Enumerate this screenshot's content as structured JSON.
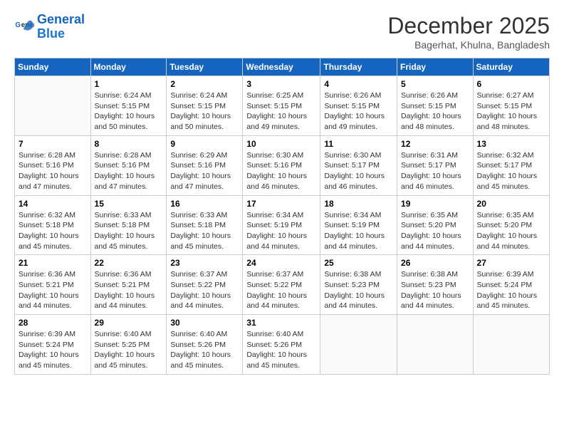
{
  "logo": {
    "line1": "General",
    "line2": "Blue"
  },
  "title": "December 2025",
  "subtitle": "Bagerhat, Khulna, Bangladesh",
  "weekdays": [
    "Sunday",
    "Monday",
    "Tuesday",
    "Wednesday",
    "Thursday",
    "Friday",
    "Saturday"
  ],
  "weeks": [
    [
      {
        "day": "",
        "sunrise": "",
        "sunset": "",
        "daylight": ""
      },
      {
        "day": "1",
        "sunrise": "Sunrise: 6:24 AM",
        "sunset": "Sunset: 5:15 PM",
        "daylight": "Daylight: 10 hours and 50 minutes."
      },
      {
        "day": "2",
        "sunrise": "Sunrise: 6:24 AM",
        "sunset": "Sunset: 5:15 PM",
        "daylight": "Daylight: 10 hours and 50 minutes."
      },
      {
        "day": "3",
        "sunrise": "Sunrise: 6:25 AM",
        "sunset": "Sunset: 5:15 PM",
        "daylight": "Daylight: 10 hours and 49 minutes."
      },
      {
        "day": "4",
        "sunrise": "Sunrise: 6:26 AM",
        "sunset": "Sunset: 5:15 PM",
        "daylight": "Daylight: 10 hours and 49 minutes."
      },
      {
        "day": "5",
        "sunrise": "Sunrise: 6:26 AM",
        "sunset": "Sunset: 5:15 PM",
        "daylight": "Daylight: 10 hours and 48 minutes."
      },
      {
        "day": "6",
        "sunrise": "Sunrise: 6:27 AM",
        "sunset": "Sunset: 5:15 PM",
        "daylight": "Daylight: 10 hours and 48 minutes."
      }
    ],
    [
      {
        "day": "7",
        "sunrise": "Sunrise: 6:28 AM",
        "sunset": "Sunset: 5:16 PM",
        "daylight": "Daylight: 10 hours and 47 minutes."
      },
      {
        "day": "8",
        "sunrise": "Sunrise: 6:28 AM",
        "sunset": "Sunset: 5:16 PM",
        "daylight": "Daylight: 10 hours and 47 minutes."
      },
      {
        "day": "9",
        "sunrise": "Sunrise: 6:29 AM",
        "sunset": "Sunset: 5:16 PM",
        "daylight": "Daylight: 10 hours and 47 minutes."
      },
      {
        "day": "10",
        "sunrise": "Sunrise: 6:30 AM",
        "sunset": "Sunset: 5:16 PM",
        "daylight": "Daylight: 10 hours and 46 minutes."
      },
      {
        "day": "11",
        "sunrise": "Sunrise: 6:30 AM",
        "sunset": "Sunset: 5:17 PM",
        "daylight": "Daylight: 10 hours and 46 minutes."
      },
      {
        "day": "12",
        "sunrise": "Sunrise: 6:31 AM",
        "sunset": "Sunset: 5:17 PM",
        "daylight": "Daylight: 10 hours and 46 minutes."
      },
      {
        "day": "13",
        "sunrise": "Sunrise: 6:32 AM",
        "sunset": "Sunset: 5:17 PM",
        "daylight": "Daylight: 10 hours and 45 minutes."
      }
    ],
    [
      {
        "day": "14",
        "sunrise": "Sunrise: 6:32 AM",
        "sunset": "Sunset: 5:18 PM",
        "daylight": "Daylight: 10 hours and 45 minutes."
      },
      {
        "day": "15",
        "sunrise": "Sunrise: 6:33 AM",
        "sunset": "Sunset: 5:18 PM",
        "daylight": "Daylight: 10 hours and 45 minutes."
      },
      {
        "day": "16",
        "sunrise": "Sunrise: 6:33 AM",
        "sunset": "Sunset: 5:18 PM",
        "daylight": "Daylight: 10 hours and 45 minutes."
      },
      {
        "day": "17",
        "sunrise": "Sunrise: 6:34 AM",
        "sunset": "Sunset: 5:19 PM",
        "daylight": "Daylight: 10 hours and 44 minutes."
      },
      {
        "day": "18",
        "sunrise": "Sunrise: 6:34 AM",
        "sunset": "Sunset: 5:19 PM",
        "daylight": "Daylight: 10 hours and 44 minutes."
      },
      {
        "day": "19",
        "sunrise": "Sunrise: 6:35 AM",
        "sunset": "Sunset: 5:20 PM",
        "daylight": "Daylight: 10 hours and 44 minutes."
      },
      {
        "day": "20",
        "sunrise": "Sunrise: 6:35 AM",
        "sunset": "Sunset: 5:20 PM",
        "daylight": "Daylight: 10 hours and 44 minutes."
      }
    ],
    [
      {
        "day": "21",
        "sunrise": "Sunrise: 6:36 AM",
        "sunset": "Sunset: 5:21 PM",
        "daylight": "Daylight: 10 hours and 44 minutes."
      },
      {
        "day": "22",
        "sunrise": "Sunrise: 6:36 AM",
        "sunset": "Sunset: 5:21 PM",
        "daylight": "Daylight: 10 hours and 44 minutes."
      },
      {
        "day": "23",
        "sunrise": "Sunrise: 6:37 AM",
        "sunset": "Sunset: 5:22 PM",
        "daylight": "Daylight: 10 hours and 44 minutes."
      },
      {
        "day": "24",
        "sunrise": "Sunrise: 6:37 AM",
        "sunset": "Sunset: 5:22 PM",
        "daylight": "Daylight: 10 hours and 44 minutes."
      },
      {
        "day": "25",
        "sunrise": "Sunrise: 6:38 AM",
        "sunset": "Sunset: 5:23 PM",
        "daylight": "Daylight: 10 hours and 44 minutes."
      },
      {
        "day": "26",
        "sunrise": "Sunrise: 6:38 AM",
        "sunset": "Sunset: 5:23 PM",
        "daylight": "Daylight: 10 hours and 44 minutes."
      },
      {
        "day": "27",
        "sunrise": "Sunrise: 6:39 AM",
        "sunset": "Sunset: 5:24 PM",
        "daylight": "Daylight: 10 hours and 45 minutes."
      }
    ],
    [
      {
        "day": "28",
        "sunrise": "Sunrise: 6:39 AM",
        "sunset": "Sunset: 5:24 PM",
        "daylight": "Daylight: 10 hours and 45 minutes."
      },
      {
        "day": "29",
        "sunrise": "Sunrise: 6:40 AM",
        "sunset": "Sunset: 5:25 PM",
        "daylight": "Daylight: 10 hours and 45 minutes."
      },
      {
        "day": "30",
        "sunrise": "Sunrise: 6:40 AM",
        "sunset": "Sunset: 5:26 PM",
        "daylight": "Daylight: 10 hours and 45 minutes."
      },
      {
        "day": "31",
        "sunrise": "Sunrise: 6:40 AM",
        "sunset": "Sunset: 5:26 PM",
        "daylight": "Daylight: 10 hours and 45 minutes."
      },
      {
        "day": "",
        "sunrise": "",
        "sunset": "",
        "daylight": ""
      },
      {
        "day": "",
        "sunrise": "",
        "sunset": "",
        "daylight": ""
      },
      {
        "day": "",
        "sunrise": "",
        "sunset": "",
        "daylight": ""
      }
    ]
  ]
}
